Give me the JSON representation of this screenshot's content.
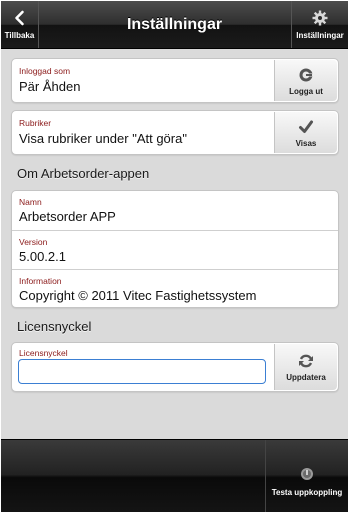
{
  "header": {
    "title": "Inställningar",
    "back_label": "Tillbaka",
    "settings_label": "Inställningar"
  },
  "account": {
    "logged_in_label": "Inloggad som",
    "logged_in_value": "Pär Åhden",
    "logout_label": "Logga ut"
  },
  "headings": {
    "label": "Rubriker",
    "value": "Visa rubriker under \"Att göra\"",
    "toggle_label": "Visas"
  },
  "about": {
    "section_title": "Om Arbetsorder-appen",
    "name_label": "Namn",
    "name_value": "Arbetsorder APP",
    "version_label": "Version",
    "version_value": "5.00.2.1",
    "info_label": "Information",
    "info_value": "Copyright © 2011 Vitec Fastighetssystem"
  },
  "license": {
    "section_title": "Licensnyckel",
    "field_label": "Licensnyckel",
    "field_value": "",
    "update_label": "Uppdatera"
  },
  "footer": {
    "test_connection_label": "Testa uppkoppling"
  },
  "colors": {
    "label_red": "#8b1a1a",
    "input_focus": "#3b7fd3",
    "page_bg": "#dadada"
  }
}
